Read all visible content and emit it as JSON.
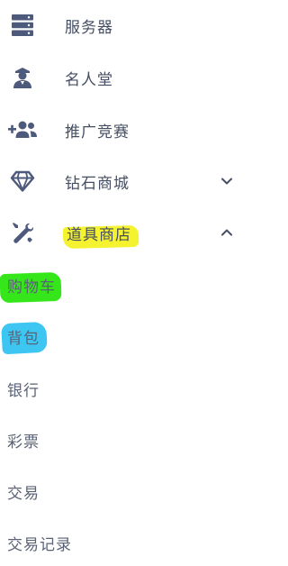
{
  "menu": {
    "items": [
      {
        "label": "服务器",
        "icon": "server-icon"
      },
      {
        "label": "名人堂",
        "icon": "hall-of-fame-icon"
      },
      {
        "label": "推广竞赛",
        "icon": "add-users-icon"
      },
      {
        "label": "钻石商城",
        "icon": "diamond-icon",
        "chevron": "down"
      },
      {
        "label": "道具商店",
        "icon": "tools-icon",
        "chevron": "up"
      }
    ],
    "sub_items": [
      {
        "label": "购物车"
      },
      {
        "label": "背包"
      },
      {
        "label": "银行"
      },
      {
        "label": "彩票"
      },
      {
        "label": "交易"
      },
      {
        "label": "交易记录"
      }
    ]
  },
  "colors": {
    "text": "#454e63",
    "icon": "#4d5a7c",
    "highlight_yellow": "#f5f230",
    "highlight_green": "#35e61a",
    "highlight_blue": "#3ec6f2"
  }
}
